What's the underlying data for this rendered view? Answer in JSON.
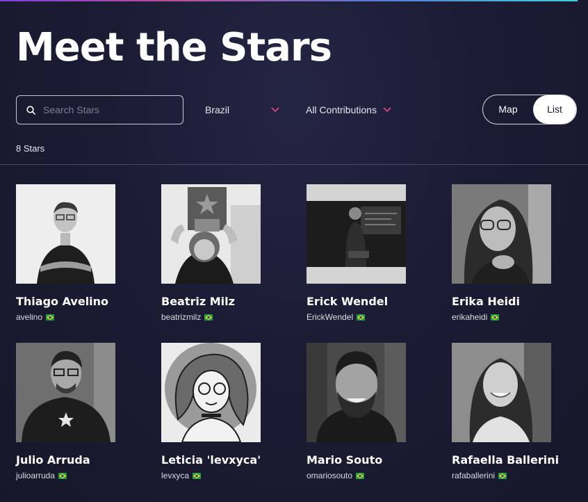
{
  "page": {
    "title": "Meet the Stars"
  },
  "search": {
    "placeholder": "Search Stars",
    "value": ""
  },
  "filters": {
    "country": "Brazil",
    "contribution": "All Contributions"
  },
  "view_toggle": {
    "map_label": "Map",
    "list_label": "List",
    "active": "List"
  },
  "results": {
    "count_label": "8 Stars"
  },
  "stars": [
    {
      "name": "Thiago Avelino",
      "handle": "avelino",
      "country_flag": "brazil-flag-icon"
    },
    {
      "name": "Beatriz Milz",
      "handle": "beatrizmilz",
      "country_flag": "brazil-flag-icon"
    },
    {
      "name": "Erick Wendel",
      "handle": "ErickWendel",
      "country_flag": "brazil-flag-icon"
    },
    {
      "name": "Erika Heidi",
      "handle": "erikaheidi",
      "country_flag": "brazil-flag-icon"
    },
    {
      "name": "Julio Arruda",
      "handle": "julioarruda",
      "country_flag": "brazil-flag-icon"
    },
    {
      "name": "Leticia 'levxyca'",
      "handle": "levxyca",
      "country_flag": "brazil-flag-icon"
    },
    {
      "name": "Mario Souto",
      "handle": "omariosouto",
      "country_flag": "brazil-flag-icon"
    },
    {
      "name": "Rafaella Ballerini",
      "handle": "rafaballerini",
      "country_flag": "brazil-flag-icon"
    }
  ],
  "colors": {
    "background": "#1b1c34",
    "accent_chevron": "#e0457b",
    "text": "#ffffff"
  }
}
